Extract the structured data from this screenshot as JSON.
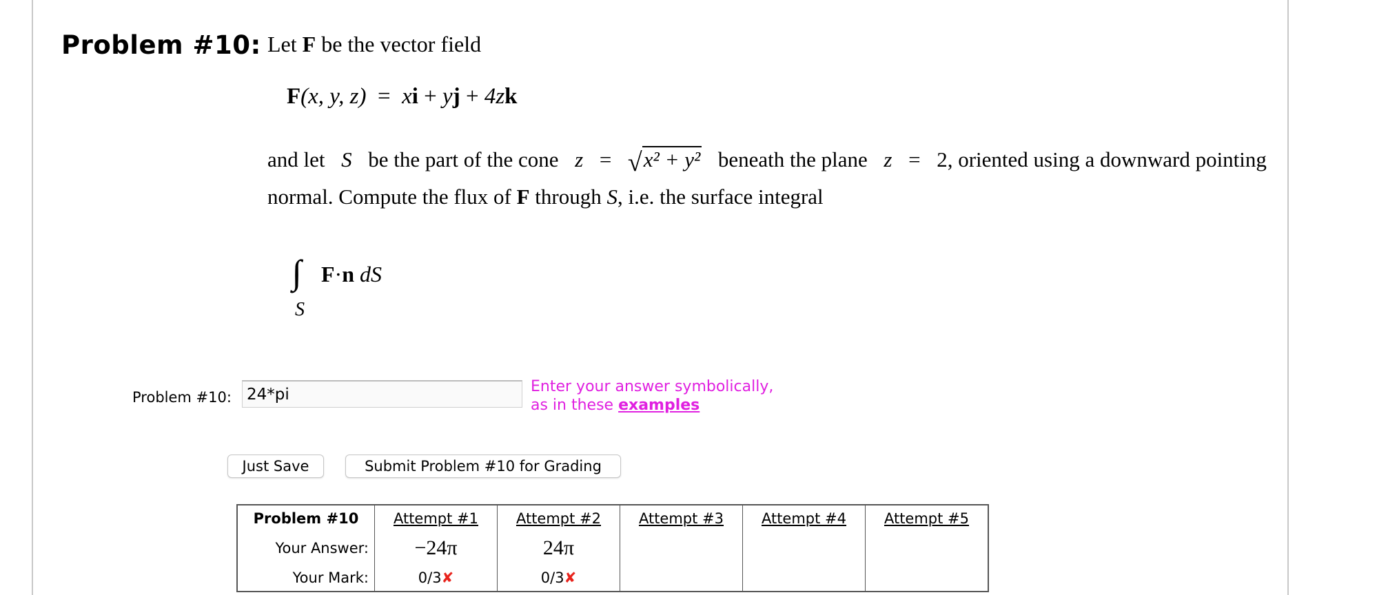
{
  "problem": {
    "heading": "Problem #10:",
    "intro_pre": "Let",
    "intro_F": "F",
    "intro_post": "be the vector field",
    "field": {
      "lhs_F": "F",
      "lhs_args": "(x, y, z)",
      "eq": "=",
      "t1": "x",
      "i": "i",
      "plus1": "+",
      "t2": "y",
      "j": "j",
      "plus2": "+",
      "t3": "4z",
      "k": "k"
    },
    "para": {
      "p1": "and let",
      "S": "S",
      "p2": "be the part of the cone",
      "z": "z",
      "eq": "=",
      "radicand": "x² + y²",
      "p3": "beneath the plane",
      "z2": "z",
      "eq2": "=",
      "p4": "2, oriented using a downward pointing",
      "p5": "normal. Compute the flux of",
      "F": "F",
      "p6": "through",
      "S2": "S",
      "p7": ", i.e. the surface integral"
    },
    "integral": {
      "sign": "∫∫",
      "sub": "S",
      "F": "F",
      "dot": "·",
      "n": "n",
      "dS": "dS"
    }
  },
  "answer": {
    "label": "Problem #10:",
    "value": "24*pi",
    "hint_line1": "Enter your answer symbolically,",
    "hint_line2_pre": "as in these",
    "hint_link": "examples"
  },
  "buttons": {
    "save": "Just Save",
    "submit": "Submit Problem #10 for Grading"
  },
  "attempts_table": {
    "header": "Problem #10",
    "answer_row_label": "Your Answer:",
    "mark_row_label": "Your Mark:",
    "attempts": [
      {
        "label": "Attempt #1",
        "answer": "−24π",
        "mark": "0/3",
        "mark_icon": "✘"
      },
      {
        "label": "Attempt #2",
        "answer": "24π",
        "mark": "0/3",
        "mark_icon": "✘"
      },
      {
        "label": "Attempt #3",
        "answer": "",
        "mark": "",
        "mark_icon": ""
      },
      {
        "label": "Attempt #4",
        "answer": "",
        "mark": "",
        "mark_icon": ""
      },
      {
        "label": "Attempt #5",
        "answer": "",
        "mark": "",
        "mark_icon": ""
      }
    ]
  }
}
